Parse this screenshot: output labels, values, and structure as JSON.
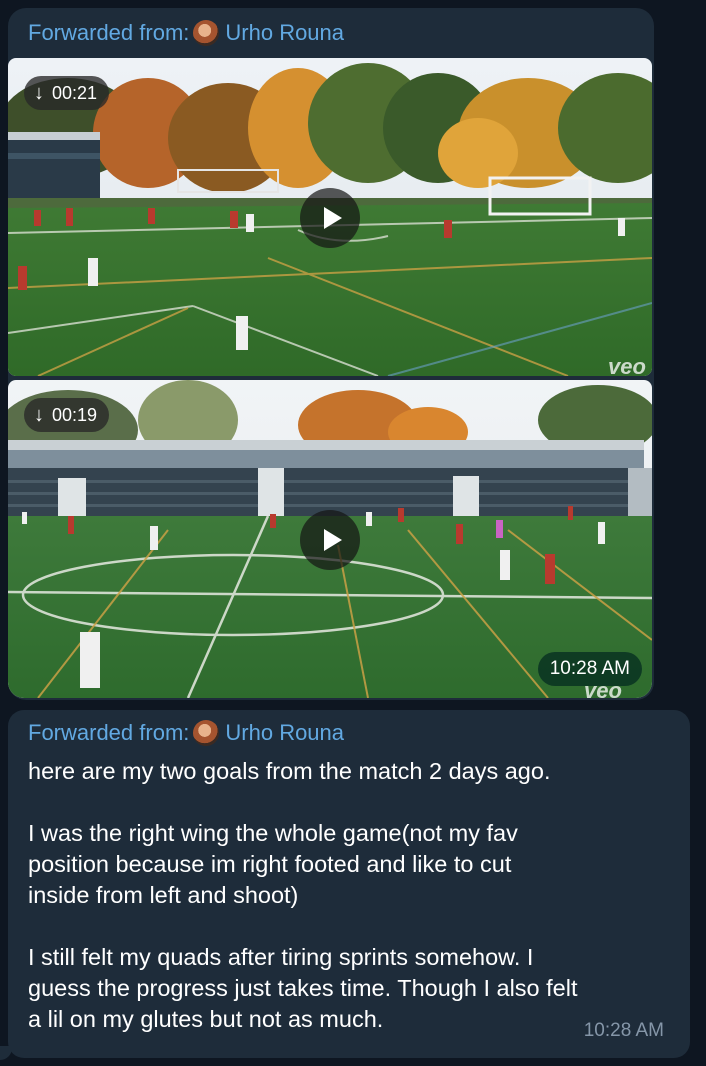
{
  "forward_label": "Forwarded from:",
  "sender_name": "Urho Rouna",
  "videos": [
    {
      "duration": "00:21"
    },
    {
      "duration": "00:19",
      "sent_time": "10:28 AM"
    }
  ],
  "watermark": "veo",
  "text_message": {
    "paragraphs": [
      "here are my two goals from the match 2 days ago.",
      "I was the right wing the whole game(not my fav\nposition because im right footed and like to cut\ninside from left and shoot)",
      "I still felt my quads after tiring sprints somehow. I\nguess the progress just takes time. Though I also felt\na lil on my glutes but not as much."
    ],
    "time": "10:28 AM"
  },
  "colors": {
    "background": "#0e1621",
    "bubble": "#1e2c3a",
    "link": "#62a9e2",
    "time_badge": "#0c3723"
  }
}
